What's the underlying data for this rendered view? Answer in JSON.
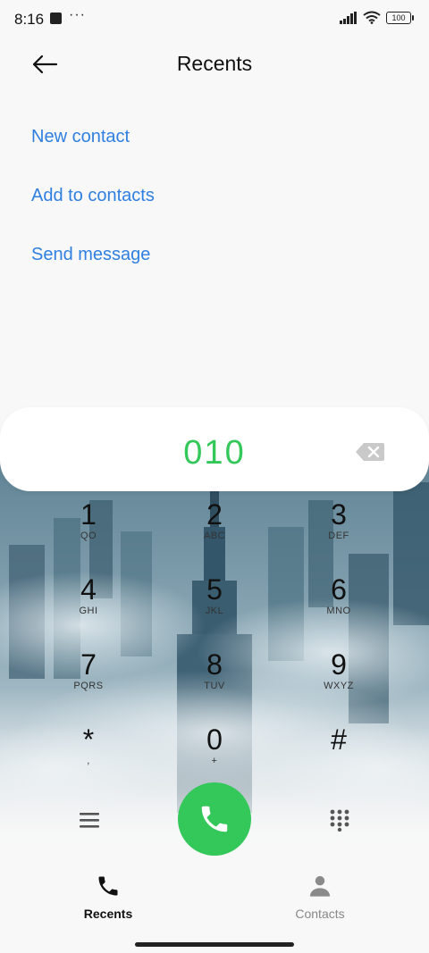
{
  "status_bar": {
    "time": "8:16",
    "dots": "···",
    "battery": "100"
  },
  "header": {
    "title": "Recents"
  },
  "actions": {
    "new_contact": "New contact",
    "add_to_contacts": "Add to contacts",
    "send_message": "Send message"
  },
  "dialer": {
    "number": "010",
    "keys": [
      {
        "digit": "1",
        "letters": "QO"
      },
      {
        "digit": "2",
        "letters": "ABC"
      },
      {
        "digit": "3",
        "letters": "DEF"
      },
      {
        "digit": "4",
        "letters": "GHI"
      },
      {
        "digit": "5",
        "letters": "JKL"
      },
      {
        "digit": "6",
        "letters": "MNO"
      },
      {
        "digit": "7",
        "letters": "PQRS"
      },
      {
        "digit": "8",
        "letters": "TUV"
      },
      {
        "digit": "9",
        "letters": "WXYZ"
      },
      {
        "digit": "*",
        "letters": ","
      },
      {
        "digit": "0",
        "letters": "+"
      },
      {
        "digit": "#",
        "letters": ""
      }
    ]
  },
  "bottom_nav": {
    "recents": "Recents",
    "contacts": "Contacts"
  },
  "colors": {
    "accent_link": "#2f7fe0",
    "call_green": "#34c759",
    "number_green": "#34c759"
  },
  "icons": {
    "back": "arrow-left-icon",
    "backspace": "backspace-icon",
    "menu": "menu-icon",
    "call": "phone-icon",
    "keypad": "keypad-icon",
    "recents": "phone-icon",
    "contacts": "person-icon"
  }
}
